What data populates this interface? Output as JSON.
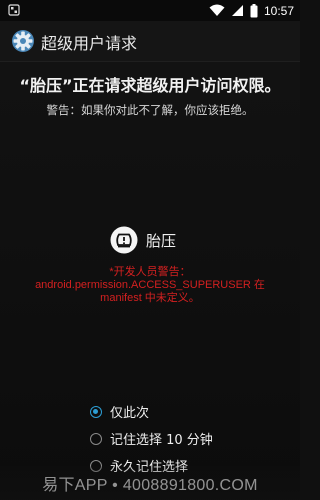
{
  "status_bar": {
    "time": "10:57",
    "icons": [
      "notification-icon",
      "wifi-icon",
      "signal-icon",
      "battery-icon"
    ]
  },
  "action_bar": {
    "title": "超级用户请求",
    "icon": "gear-icon"
  },
  "request": {
    "title": "“胎压”正在请求超级用户访问权限。",
    "warning": "警告：如果你对此不了解，你应该拒绝。"
  },
  "app": {
    "name": "胎压",
    "icon": "tire-pressure-icon"
  },
  "developer_warning": {
    "line1": "*开发人员警告：",
    "line2": "android.permission.ACCESS_SUPERUSER 在",
    "line3": "manifest 中未定义。"
  },
  "options": [
    {
      "label": "仅此次",
      "selected": true
    },
    {
      "label": "记住选择 10 分钟",
      "selected": false
    },
    {
      "label": "永久记住选择",
      "selected": false
    }
  ],
  "watermark": "易下APP • 4008891800.COM",
  "colors": {
    "accent": "#2d9ed4",
    "warning_red": "#d32020",
    "background": "#101010"
  }
}
